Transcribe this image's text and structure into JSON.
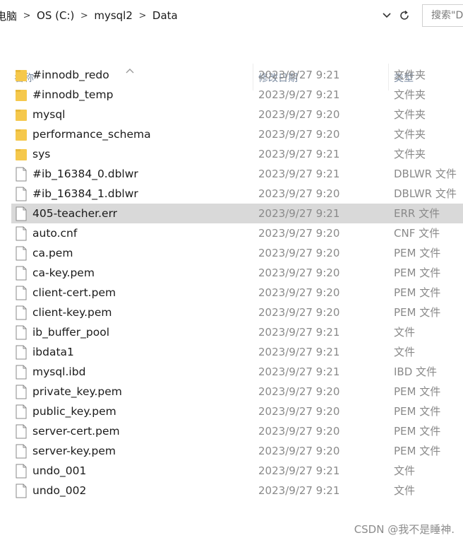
{
  "breadcrumb": [
    "电脑",
    "OS (C:)",
    "mysql2",
    "Data"
  ],
  "search": {
    "placeholder": "搜索\"D"
  },
  "columns": {
    "name": "名称",
    "date": "修改日期",
    "type": "类型"
  },
  "rows": [
    {
      "name": "#innodb_redo",
      "date": "2023/9/27 9:21",
      "type": "文件夹",
      "icon": "folder-icon"
    },
    {
      "name": "#innodb_temp",
      "date": "2023/9/27 9:21",
      "type": "文件夹",
      "icon": "folder-icon"
    },
    {
      "name": "mysql",
      "date": "2023/9/27 9:20",
      "type": "文件夹",
      "icon": "folder-icon"
    },
    {
      "name": "performance_schema",
      "date": "2023/9/27 9:20",
      "type": "文件夹",
      "icon": "folder-icon"
    },
    {
      "name": "sys",
      "date": "2023/9/27 9:21",
      "type": "文件夹",
      "icon": "folder-icon"
    },
    {
      "name": "#ib_16384_0.dblwr",
      "date": "2023/9/27 9:21",
      "type": "DBLWR 文件",
      "icon": "file-icon"
    },
    {
      "name": "#ib_16384_1.dblwr",
      "date": "2023/9/27 9:20",
      "type": "DBLWR 文件",
      "icon": "file-icon"
    },
    {
      "name": "405-teacher.err",
      "date": "2023/9/27 9:21",
      "type": "ERR 文件",
      "icon": "file-icon",
      "selected": true
    },
    {
      "name": "auto.cnf",
      "date": "2023/9/27 9:20",
      "type": "CNF 文件",
      "icon": "file-icon"
    },
    {
      "name": "ca.pem",
      "date": "2023/9/27 9:20",
      "type": "PEM 文件",
      "icon": "file-icon"
    },
    {
      "name": "ca-key.pem",
      "date": "2023/9/27 9:20",
      "type": "PEM 文件",
      "icon": "file-icon"
    },
    {
      "name": "client-cert.pem",
      "date": "2023/9/27 9:20",
      "type": "PEM 文件",
      "icon": "file-icon"
    },
    {
      "name": "client-key.pem",
      "date": "2023/9/27 9:20",
      "type": "PEM 文件",
      "icon": "file-icon"
    },
    {
      "name": "ib_buffer_pool",
      "date": "2023/9/27 9:21",
      "type": "文件",
      "icon": "file-icon"
    },
    {
      "name": "ibdata1",
      "date": "2023/9/27 9:21",
      "type": "文件",
      "icon": "file-icon"
    },
    {
      "name": "mysql.ibd",
      "date": "2023/9/27 9:21",
      "type": "IBD 文件",
      "icon": "file-icon"
    },
    {
      "name": "private_key.pem",
      "date": "2023/9/27 9:20",
      "type": "PEM 文件",
      "icon": "file-icon"
    },
    {
      "name": "public_key.pem",
      "date": "2023/9/27 9:20",
      "type": "PEM 文件",
      "icon": "file-icon"
    },
    {
      "name": "server-cert.pem",
      "date": "2023/9/27 9:20",
      "type": "PEM 文件",
      "icon": "file-icon"
    },
    {
      "name": "server-key.pem",
      "date": "2023/9/27 9:20",
      "type": "PEM 文件",
      "icon": "file-icon"
    },
    {
      "name": "undo_001",
      "date": "2023/9/27 9:21",
      "type": "文件",
      "icon": "file-icon"
    },
    {
      "name": "undo_002",
      "date": "2023/9/27 9:21",
      "type": "文件",
      "icon": "file-icon"
    }
  ],
  "colors": {
    "folder": "#f5c84c",
    "selected": "#d9d9d9",
    "header_text": "#7a8aa0"
  },
  "watermark": "CSDN @我不是睡神."
}
